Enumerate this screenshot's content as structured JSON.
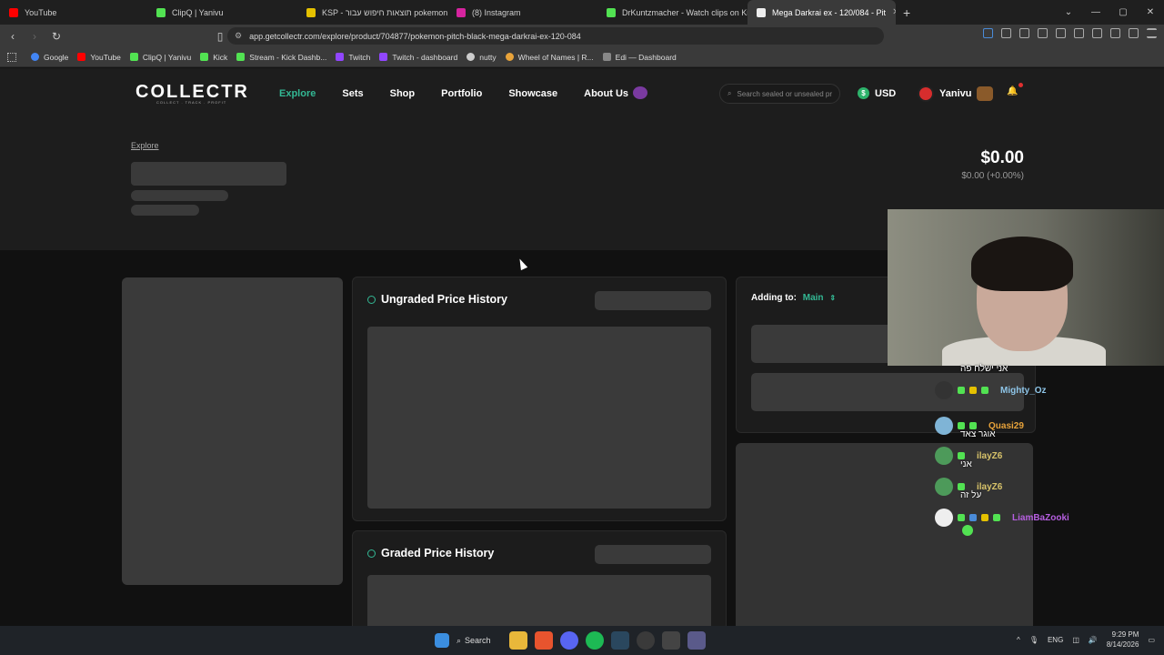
{
  "browser": {
    "tabs": [
      {
        "label": "YouTube",
        "color": "#ff0000"
      },
      {
        "label": "ClipQ | Yanivu",
        "color": "#52e252"
      },
      {
        "label": "KSP - תוצאות חיפוש עבור pokemon",
        "color": "#e5c100"
      },
      {
        "label": "(8) Instagram",
        "color": "#d6249f"
      },
      {
        "label": "DrKuntzmacher - Watch clips on Kick",
        "color": "#52e252"
      },
      {
        "label": "Mega Darkrai ex - 120/084 - Pit",
        "color": "#eeeeee"
      }
    ],
    "url": "app.getcollectr.com/explore/product/704877/pokemon-pitch-black-mega-darkrai-ex-120-084",
    "bookmarks": [
      {
        "label": "Google",
        "color": "#4285f4"
      },
      {
        "label": "YouTube",
        "color": "#ff0000"
      },
      {
        "label": "ClipQ | Yanivu",
        "color": "#52e252"
      },
      {
        "label": "Kick",
        "color": "#52e252"
      },
      {
        "label": "Stream - Kick Dashb...",
        "color": "#52e252"
      },
      {
        "label": "Twitch",
        "color": "#9146ff"
      },
      {
        "label": "Twitch - dashboard",
        "color": "#9146ff"
      },
      {
        "label": "nutty",
        "color": "#cccccc"
      },
      {
        "label": "Wheel of Names | R...",
        "color": "#e8a33a"
      },
      {
        "label": "Edi — Dashboard",
        "color": "#888888"
      }
    ]
  },
  "site": {
    "logo": "COLLECTR",
    "logo_tagline": "COLLECT . TRACK . PROFIT",
    "nav": [
      "Explore",
      "Sets",
      "Shop",
      "Portfolio",
      "Showcase",
      "About Us"
    ],
    "search_placeholder": "Search sealed or unsealed pr",
    "currency": "USD",
    "currency_symbol": "$",
    "username": "Yanivu",
    "breadcrumb": "Explore",
    "price": "$0.00",
    "price_change": "$0.00 (+0.00%)",
    "ungraded_title": "Ungraded Price History",
    "graded_title": "Graded Price History",
    "adding_to_label": "Adding to:",
    "adding_to_value": "Main",
    "accent": "#33b894"
  },
  "chat": [
    {
      "user": "",
      "message": "אני ישלח פה",
      "color": "#ffffff"
    },
    {
      "user": "Mighty_Oz",
      "message": "",
      "color": "#8ec5e8"
    },
    {
      "user": "Quasi29",
      "message": "אוגר צאד",
      "color": "#e8a33a"
    },
    {
      "user": "ilayZ6",
      "message": "אני",
      "color": "#d8c36a"
    },
    {
      "user": "ilayZ6",
      "message": "על זה",
      "color": "#d8c36a"
    },
    {
      "user": "LiamBaZooki",
      "message": "",
      "color": "#b65fe0"
    }
  ],
  "taskbar": {
    "search_label": "Search",
    "language": "ENG",
    "time": "9:29 PM",
    "date": "8/14/2026"
  }
}
